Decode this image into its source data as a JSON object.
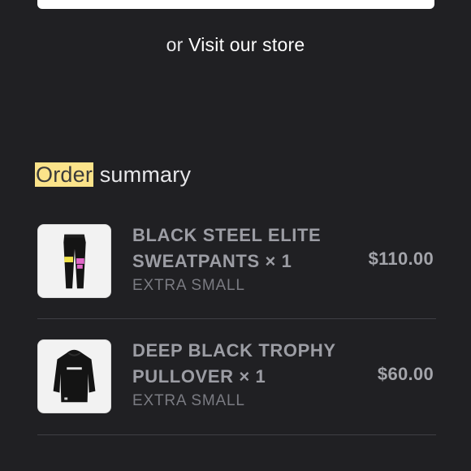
{
  "checkout": {
    "alt_prefix": "or",
    "alt_link": "Visit our store"
  },
  "summary": {
    "heading_highlight": "Order",
    "heading_rest": " summary"
  },
  "items": [
    {
      "name": "BLACK STEEL ELITE SWEATPANTS",
      "quantity": "× 1",
      "variant": "EXTRA SMALL",
      "price": "$110.00",
      "image_icon": "sweatpants-image"
    },
    {
      "name": "DEEP BLACK TROPHY PULLOVER",
      "quantity": "× 1",
      "variant": "EXTRA SMALL",
      "price": "$60.00",
      "image_icon": "hoodie-image"
    }
  ],
  "colors": {
    "background": "#202023",
    "highlight": "#fbe38a"
  }
}
